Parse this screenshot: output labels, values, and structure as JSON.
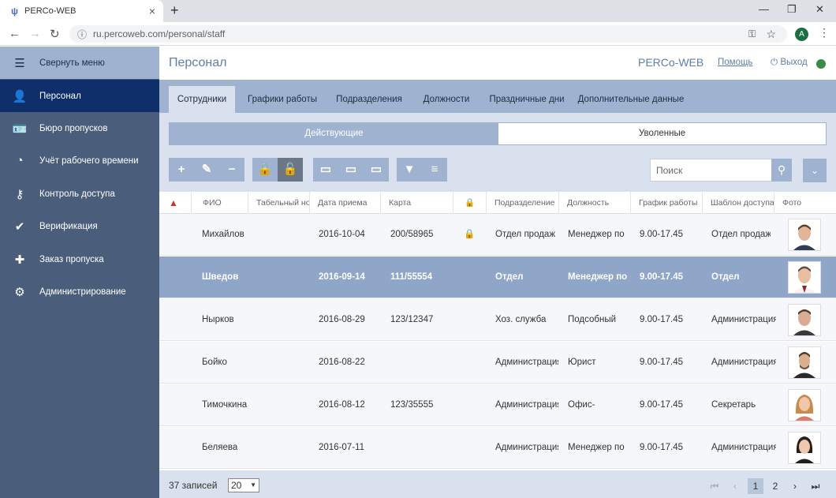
{
  "browser": {
    "tab_title": "PERCo-WEB",
    "url": "ru.percoweb.com/personal/staff",
    "profile_initial": "A"
  },
  "sidebar": {
    "items": [
      {
        "label": "Свернуть меню",
        "icon": "hamburger-icon"
      },
      {
        "label": "Персонал",
        "icon": "user-icon"
      },
      {
        "label": "Бюро пропусков",
        "icon": "badge-icon"
      },
      {
        "label": "Учёт рабочего времени",
        "icon": "clock-icon"
      },
      {
        "label": "Контроль доступа",
        "icon": "key-icon"
      },
      {
        "label": "Верификация",
        "icon": "verify-icon"
      },
      {
        "label": "Заказ пропуска",
        "icon": "order-pass-icon"
      },
      {
        "label": "Администрирование",
        "icon": "gear-icon"
      }
    ]
  },
  "header": {
    "title": "Персонал",
    "brand": "PERCo-WEB",
    "help": "Помощь",
    "logout": "Выход"
  },
  "tabs": [
    "Сотрудники",
    "Графики работы",
    "Подразделения",
    "Должности",
    "Праздничные дни",
    "Дополнительные данные"
  ],
  "segments": {
    "active": "Действующие",
    "dismissed": "Уволенные"
  },
  "search": {
    "placeholder": "Поиск",
    "value": ""
  },
  "table": {
    "columns": [
      "ФИО",
      "Табельный номер",
      "Дата приема",
      "Карта",
      "Подразделение",
      "Должность",
      "График работы",
      "Шаблон доступа",
      "Фото"
    ],
    "rows": [
      {
        "name": "Михайлов",
        "date": "2016-10-04",
        "card": "200/58965",
        "locked": true,
        "dept": "Отдел продаж",
        "position": "Менеджер по",
        "schedule": "9.00-17.45",
        "template": "Отдел продаж"
      },
      {
        "name": "Шведов",
        "date": "2016-09-14",
        "card": "111/55554",
        "locked": false,
        "dept": "Отдел",
        "position": "Менеджер по",
        "schedule": "9.00-17.45",
        "template": "Отдел"
      },
      {
        "name": "Нырков",
        "date": "2016-08-29",
        "card": "123/12347",
        "locked": false,
        "dept": "Хоз. служба",
        "position": "Подсобный",
        "schedule": "9.00-17.45",
        "template": "Администрация"
      },
      {
        "name": "Бойко",
        "date": "2016-08-22",
        "card": "",
        "locked": false,
        "dept": "Администрация",
        "position": "Юрист",
        "schedule": "9.00-17.45",
        "template": "Администрация"
      },
      {
        "name": "Тимочкина",
        "date": "2016-08-12",
        "card": "123/35555",
        "locked": false,
        "dept": "Администрация",
        "position": "Офис-",
        "schedule": "9.00-17.45",
        "template": "Секретарь"
      },
      {
        "name": "Беляева",
        "date": "2016-07-11",
        "card": "",
        "locked": false,
        "dept": "Администрация",
        "position": "Менеджер по",
        "schedule": "9.00-17.45",
        "template": "Администрация"
      }
    ],
    "selected_row": 1
  },
  "footer": {
    "count": "37 записей",
    "page_size": "20",
    "pages": [
      "1",
      "2"
    ]
  },
  "colors": {
    "sidebar": "#4a5e7c",
    "sidebar_active": "#0f2f6b",
    "accent": "#9fb3d1",
    "selected_row": "#8fa6c9"
  }
}
